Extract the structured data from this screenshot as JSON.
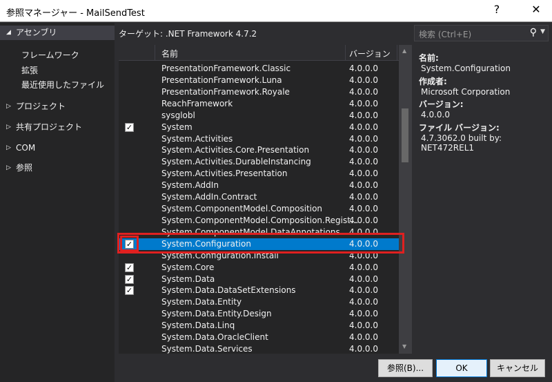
{
  "window": {
    "title": "参照マネージャー - MailSendTest",
    "help": "?",
    "close": "✕"
  },
  "left": {
    "assemblies": "アセンブリ",
    "sub": [
      "フレームワーク",
      "拡張",
      "最近使用したファイル"
    ],
    "groups": [
      "プロジェクト",
      "共有プロジェクト",
      "COM",
      "参照"
    ]
  },
  "target": "ターゲット: .NET Framework 4.7.2",
  "search": {
    "placeholder": "検索 (Ctrl+E)"
  },
  "list": {
    "headers": {
      "name": "名前",
      "version": "バージョン"
    },
    "rows": [
      {
        "name": "PresentationFramework.Classic",
        "version": "4.0.0.0",
        "checked": false
      },
      {
        "name": "PresentationFramework.Luna",
        "version": "4.0.0.0",
        "checked": false
      },
      {
        "name": "PresentationFramework.Royale",
        "version": "4.0.0.0",
        "checked": false
      },
      {
        "name": "ReachFramework",
        "version": "4.0.0.0",
        "checked": false
      },
      {
        "name": "sysglobl",
        "version": "4.0.0.0",
        "checked": false
      },
      {
        "name": "System",
        "version": "4.0.0.0",
        "checked": true
      },
      {
        "name": "System.Activities",
        "version": "4.0.0.0",
        "checked": false
      },
      {
        "name": "System.Activities.Core.Presentation",
        "version": "4.0.0.0",
        "checked": false
      },
      {
        "name": "System.Activities.DurableInstancing",
        "version": "4.0.0.0",
        "checked": false
      },
      {
        "name": "System.Activities.Presentation",
        "version": "4.0.0.0",
        "checked": false
      },
      {
        "name": "System.AddIn",
        "version": "4.0.0.0",
        "checked": false
      },
      {
        "name": "System.AddIn.Contract",
        "version": "4.0.0.0",
        "checked": false
      },
      {
        "name": "System.ComponentModel.Composition",
        "version": "4.0.0.0",
        "checked": false
      },
      {
        "name": "System.ComponentModel.Composition.Regist...",
        "version": "4.0.0.0",
        "checked": false
      },
      {
        "name": "System.ComponentModel.DataAnnotations",
        "version": "4.0.0.0",
        "checked": false
      },
      {
        "name": "System.Configuration",
        "version": "4.0.0.0",
        "checked": true,
        "selected": true
      },
      {
        "name": "System.Configuration.Install",
        "version": "4.0.0.0",
        "checked": false
      },
      {
        "name": "System.Core",
        "version": "4.0.0.0",
        "checked": true
      },
      {
        "name": "System.Data",
        "version": "4.0.0.0",
        "checked": true
      },
      {
        "name": "System.Data.DataSetExtensions",
        "version": "4.0.0.0",
        "checked": true
      },
      {
        "name": "System.Data.Entity",
        "version": "4.0.0.0",
        "checked": false
      },
      {
        "name": "System.Data.Entity.Design",
        "version": "4.0.0.0",
        "checked": false
      },
      {
        "name": "System.Data.Linq",
        "version": "4.0.0.0",
        "checked": false
      },
      {
        "name": "System.Data.OracleClient",
        "version": "4.0.0.0",
        "checked": false
      },
      {
        "name": "System.Data.Services",
        "version": "4.0.0.0",
        "checked": false
      }
    ]
  },
  "details": {
    "name_label": "名前:",
    "name": "System.Configuration",
    "author_label": "作成者:",
    "author": "Microsoft Corporation",
    "version_label": "バージョン:",
    "version": "4.0.0.0",
    "file_version_label": "ファイル バージョン:",
    "file_version": "4.7.3062.0 built by: NET472REL1"
  },
  "buttons": {
    "browse": "参照(B)...",
    "ok": "OK",
    "cancel": "キャンセル"
  }
}
